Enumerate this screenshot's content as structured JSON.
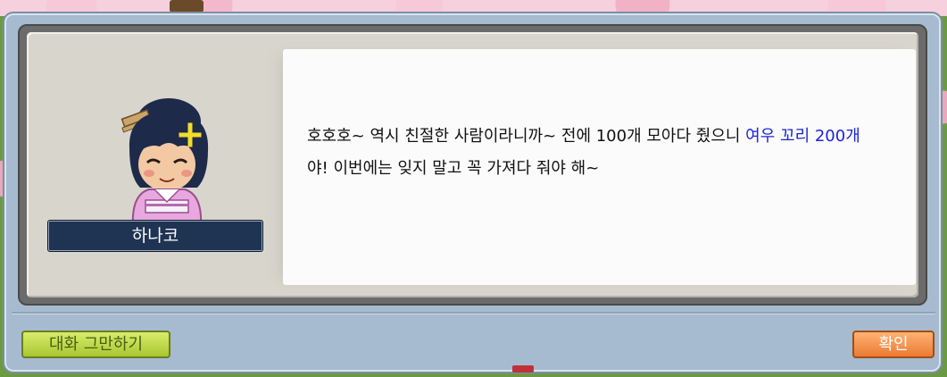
{
  "npc": {
    "name": "하나코",
    "portrait_icon": "hanako-npc-portrait"
  },
  "dialog": {
    "segments": [
      {
        "text": "호호호~ 역시 친절한 사람이라니까~ 전에 100개 모아다 줬으니 ",
        "highlight": false
      },
      {
        "text": "여우 꼬리 200개",
        "highlight": true
      },
      {
        "text": "야! 이번에는 잊지 말고 꼭 가져다 줘야 해~",
        "highlight": false
      }
    ],
    "highlight_color": "#1c24d8"
  },
  "buttons": {
    "end_chat": "대화 그만하기",
    "confirm": "확인"
  },
  "colors": {
    "end_chat_button": "#b8d444",
    "confirm_button": "#f2904a",
    "name_plate": "#1f3352",
    "window": "#a6bbcf"
  }
}
